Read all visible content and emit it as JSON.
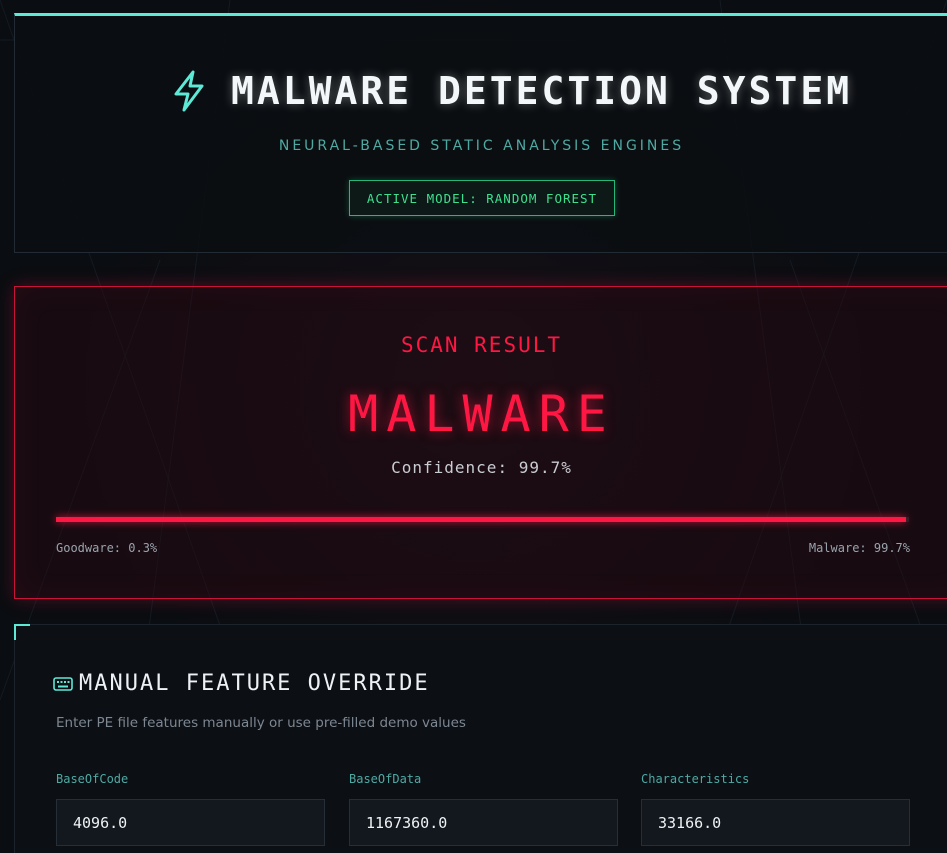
{
  "header": {
    "title": "MALWARE DETECTION SYSTEM",
    "subtitle": "NEURAL-BASED STATIC ANALYSIS ENGINES",
    "model_badge": "ACTIVE MODEL: RANDOM FOREST",
    "icon": "lightning-bolt-icon"
  },
  "result": {
    "label": "SCAN RESULT",
    "verdict": "MALWARE",
    "confidence_text": "Confidence: 99.7%",
    "malware_probability": 0.997,
    "goodware_label": "Goodware: 0.3%",
    "malware_label": "Malware: 99.7%"
  },
  "features": {
    "title": "MANUAL FEATURE OVERRIDE",
    "icon": "keyboard-icon",
    "description": "Enter PE file features manually or use pre-filled demo values",
    "fields": [
      {
        "label": "BaseOfCode",
        "value": "4096.0"
      },
      {
        "label": "BaseOfData",
        "value": "1167360.0"
      },
      {
        "label": "Characteristics",
        "value": "33166.0"
      }
    ]
  },
  "colors": {
    "accent_cyan": "#5ee8d6",
    "malware_red": "#ff1744",
    "active_green": "#3ee08f",
    "background": "#0a0d11"
  }
}
